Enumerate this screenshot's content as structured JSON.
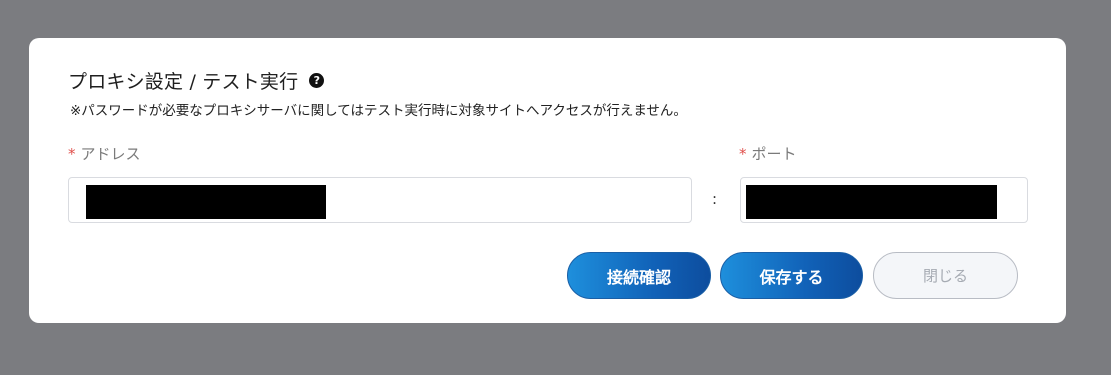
{
  "modal": {
    "title": "プロキシ設定 / テスト実行",
    "help_icon": "question-circle-icon",
    "note": "※パスワードが必要なプロキシサーバに関してはテスト実行時に対象サイトへアクセスが行えません。"
  },
  "form": {
    "address": {
      "required_mark": "*",
      "label": "アドレス"
    },
    "separator": ":",
    "port": {
      "required_mark": "*",
      "label": "ポート"
    }
  },
  "buttons": {
    "test_connection": "接続確認",
    "save": "保存する",
    "close": "閉じる"
  },
  "colors": {
    "overlay": "#7b7c80",
    "primary_start": "#1e8fdc",
    "primary_end": "#0d4d9e",
    "required": "#e0504c"
  }
}
